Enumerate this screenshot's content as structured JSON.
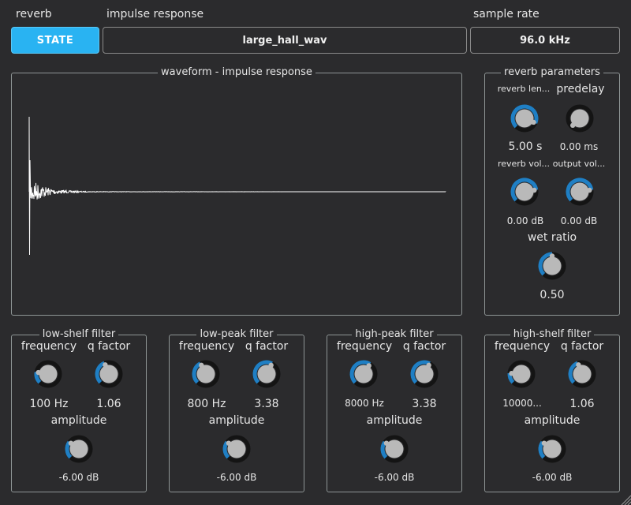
{
  "header": {
    "reverb_label": "reverb",
    "state_button": "STATE",
    "ir_label": "impulse response",
    "ir_value": "large_hall_wav",
    "sr_label": "sample rate",
    "sr_value": "96.0 kHz"
  },
  "waveform": {
    "title": "waveform - impulse response"
  },
  "reverb_params": {
    "title": "reverb parameters",
    "reverb_length": {
      "label": "reverb len...",
      "value": "5.00 s",
      "level": 0.92
    },
    "predelay": {
      "label": "predelay",
      "value": "0.00 ms",
      "level": 0.0
    },
    "reverb_volume": {
      "label": "reverb vol...",
      "value": "0.00 dB",
      "level": 0.8
    },
    "output_volume": {
      "label": "output vol...",
      "value": "0.00 dB",
      "level": 0.8
    },
    "wet_ratio": {
      "label": "wet ratio",
      "value": "0.50",
      "level": 0.5
    }
  },
  "filters": [
    {
      "title": "low-shelf filter",
      "freq_label": "frequency",
      "freq_value": "100 Hz",
      "freq_level": 0.2,
      "q_label": "q factor",
      "q_value": "1.06",
      "q_level": 0.42,
      "amp_label": "amplitude",
      "amp_value": "-6.00 dB",
      "amp_level": 0.3
    },
    {
      "title": "low-peak filter",
      "freq_label": "frequency",
      "freq_value": "800 Hz",
      "freq_level": 0.4,
      "q_label": "q factor",
      "q_value": "3.38",
      "q_level": 0.6,
      "amp_label": "amplitude",
      "amp_value": "-6.00 dB",
      "amp_level": 0.3
    },
    {
      "title": "high-peak filter",
      "freq_label": "frequency",
      "freq_value": "8000 Hz",
      "freq_level": 0.62,
      "q_label": "q factor",
      "q_value": "3.38",
      "q_level": 0.6,
      "amp_label": "amplitude",
      "amp_value": "-6.00 dB",
      "amp_level": 0.3
    },
    {
      "title": "high-shelf filter",
      "freq_label": "frequency",
      "freq_value": "10000...",
      "freq_level": 0.18,
      "q_label": "q factor",
      "q_value": "1.06",
      "q_level": 0.42,
      "amp_label": "amplitude",
      "amp_value": "-6.00 dB",
      "amp_level": 0.3
    }
  ],
  "colors": {
    "accent": "#29b3f2",
    "knob_arc": "#1f7fc4",
    "knob_track": "#141414",
    "knob_body": "#b9b9b9",
    "background": "#2b2b2d",
    "border": "#8e9595"
  }
}
